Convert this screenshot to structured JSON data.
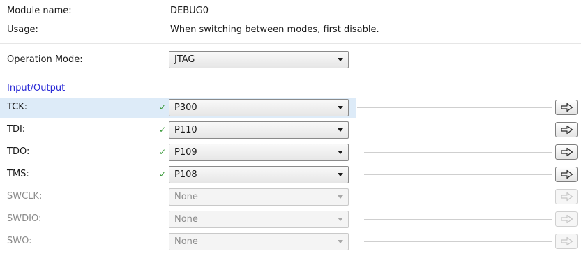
{
  "module": {
    "name_label": "Module name:",
    "name_value": "DEBUG0",
    "usage_label": "Usage:",
    "usage_value": "When switching between modes, first disable."
  },
  "operation": {
    "label": "Operation Mode:",
    "value": "JTAG"
  },
  "io": {
    "section_title": "Input/Output",
    "pins": [
      {
        "label": "TCK:",
        "value": "P300",
        "enabled": true,
        "check": "✓",
        "highlighted": true
      },
      {
        "label": "TDI:",
        "value": "P110",
        "enabled": true,
        "check": "✓",
        "highlighted": false
      },
      {
        "label": "TDO:",
        "value": "P109",
        "enabled": true,
        "check": "✓",
        "highlighted": false
      },
      {
        "label": "TMS:",
        "value": "P108",
        "enabled": true,
        "check": "✓",
        "highlighted": false
      },
      {
        "label": "SWCLK:",
        "value": "None",
        "enabled": false,
        "check": "",
        "highlighted": false
      },
      {
        "label": "SWDIO:",
        "value": "None",
        "enabled": false,
        "check": "",
        "highlighted": false
      },
      {
        "label": "SWO:",
        "value": "None",
        "enabled": false,
        "check": "",
        "highlighted": false
      }
    ]
  },
  "colors": {
    "section_title": "#2a2ad6",
    "check": "#3a9a3a",
    "highlight": "#ddebf8"
  },
  "icons": {
    "combo_arrow": "chevron-down-icon",
    "navigate": "arrow-right-icon",
    "valid": "check-icon"
  }
}
